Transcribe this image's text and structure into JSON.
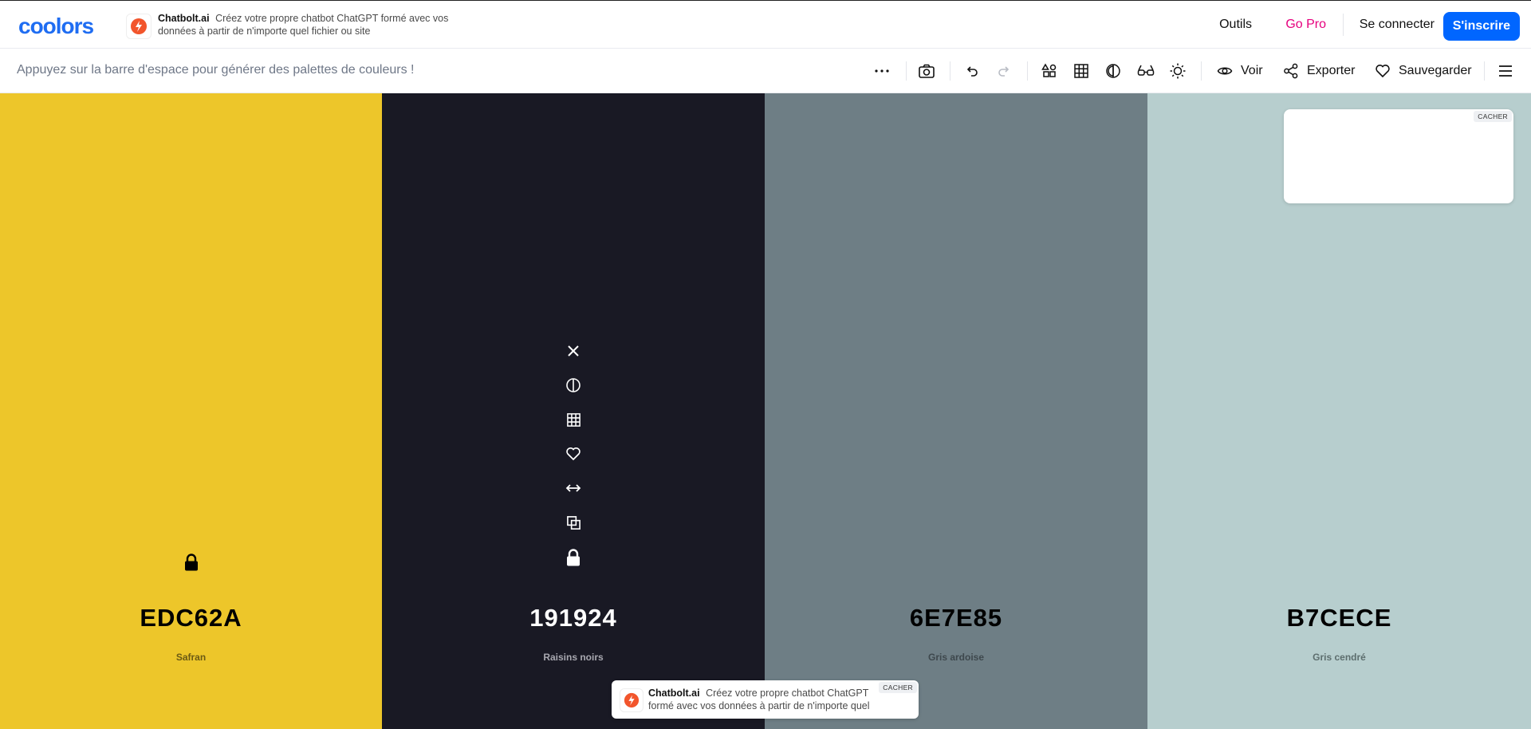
{
  "header": {
    "logo": "coolors",
    "ad": {
      "brand": "Chatbolt.ai",
      "text": "Créez votre propre chatbot ChatGPT formé avec vos données à partir de n'importe quel fichier ou site"
    },
    "nav": {
      "tools": "Outils",
      "go_pro": "Go Pro",
      "login": "Se connecter",
      "signup": "S'inscrire"
    }
  },
  "toolbar": {
    "hint": "Appuyez sur la barre d'espace pour générer des palettes de couleurs !",
    "view_label": "Voir",
    "export_label": "Exporter",
    "save_label": "Sauvegarder"
  },
  "palette": [
    {
      "hex": "EDC62A",
      "name": "Safran",
      "color": "#EDC62A",
      "text_color": "#000000",
      "name_color": "#6b5a14",
      "locked": true
    },
    {
      "hex": "191924",
      "name": "Raisins noirs",
      "color": "#191924",
      "text_color": "#ffffff",
      "name_color": "#a8a8b0",
      "locked": true
    },
    {
      "hex": "6E7E85",
      "name": "Gris ardoise",
      "color": "#6E7E85",
      "text_color": "#000000",
      "name_color": "#3e484d",
      "locked": false
    },
    {
      "hex": "B7CECE",
      "name": "Gris cendré",
      "color": "#B7CECE",
      "text_color": "#000000",
      "name_color": "#5d6e6e",
      "locked": false
    }
  ],
  "ads": {
    "hide_label": "CACHER",
    "bottom_brand": "Chatbolt.ai",
    "bottom_text": "Créez votre propre chatbot ChatGPT formé avec vos données à partir de n'importe quel"
  },
  "colors": {
    "accent": "#0066ff",
    "go_pro": "#e6007e"
  }
}
